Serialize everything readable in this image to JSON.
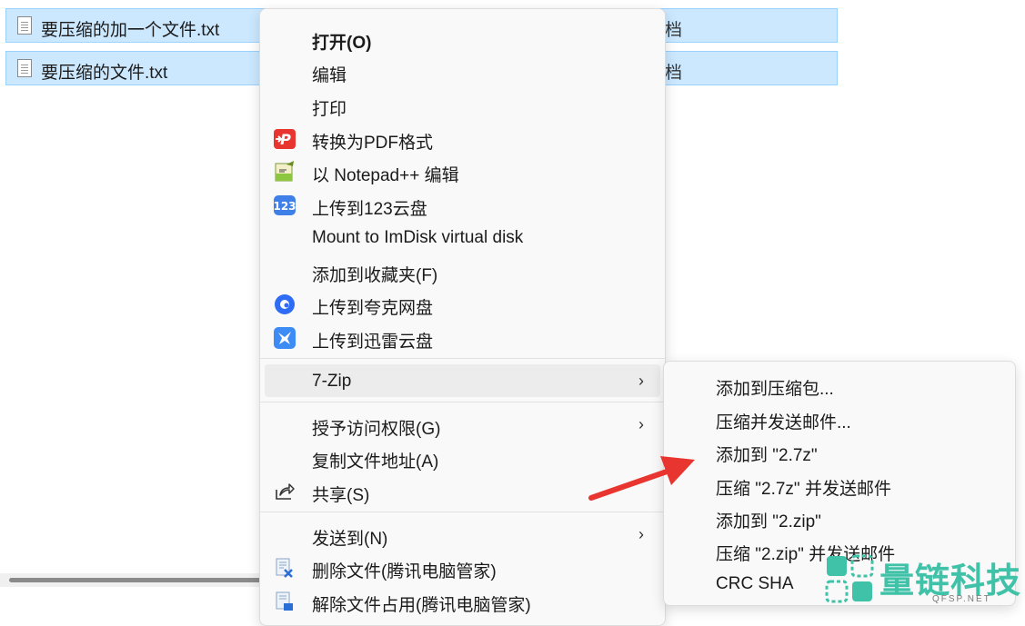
{
  "files": [
    {
      "name": "要压缩的加一个文件.txt",
      "type": "档"
    },
    {
      "name": "要压缩的文件.txt",
      "type": "档"
    }
  ],
  "menu": {
    "items": [
      {
        "label": "打开(O)",
        "icon": ""
      },
      {
        "label": "编辑",
        "icon": ""
      },
      {
        "label": "打印",
        "icon": ""
      },
      {
        "label": "转换为PDF格式",
        "icon": "pdf-convert-icon"
      },
      {
        "label": "以 Notepad++ 编辑",
        "icon": "notepad-plus-icon"
      },
      {
        "label": "上传到123云盘",
        "icon": "cloud-123-icon"
      },
      {
        "label": "Mount to ImDisk virtual disk",
        "icon": ""
      },
      {
        "label": "添加到收藏夹(F)",
        "icon": ""
      },
      {
        "label": "上传到夸克网盘",
        "icon": "quark-icon"
      },
      {
        "label": "上传到迅雷云盘",
        "icon": "xunlei-icon"
      },
      {
        "label": "7-Zip",
        "icon": "",
        "submenu": true
      },
      {
        "label": "授予访问权限(G)",
        "icon": "",
        "submenu": true
      },
      {
        "label": "复制文件地址(A)",
        "icon": ""
      },
      {
        "label": "共享(S)",
        "icon": "share-icon"
      },
      {
        "label": "发送到(N)",
        "icon": "",
        "submenu": true
      },
      {
        "label": "删除文件(腾讯电脑管家)",
        "icon": "delete-file-icon"
      },
      {
        "label": "解除文件占用(腾讯电脑管家)",
        "icon": "unlock-file-icon"
      }
    ],
    "arrow_glyph": "›"
  },
  "submenu_7zip": {
    "items": [
      {
        "label": "添加到压缩包..."
      },
      {
        "label": "压缩并发送邮件..."
      },
      {
        "label": "添加到 \"2.7z\""
      },
      {
        "label": "压缩 \"2.7z\" 并发送邮件"
      },
      {
        "label": "添加到 \"2.zip\""
      },
      {
        "label": "压缩 \"2.zip\" 并发送邮件"
      },
      {
        "label": "CRC SHA"
      }
    ]
  },
  "watermark": {
    "text": "量链科技",
    "sub": "QFSP.NET"
  },
  "colors": {
    "accent_red": "#e8352f",
    "selection": "#cce8ff",
    "watermark": "#3fc2a8"
  }
}
